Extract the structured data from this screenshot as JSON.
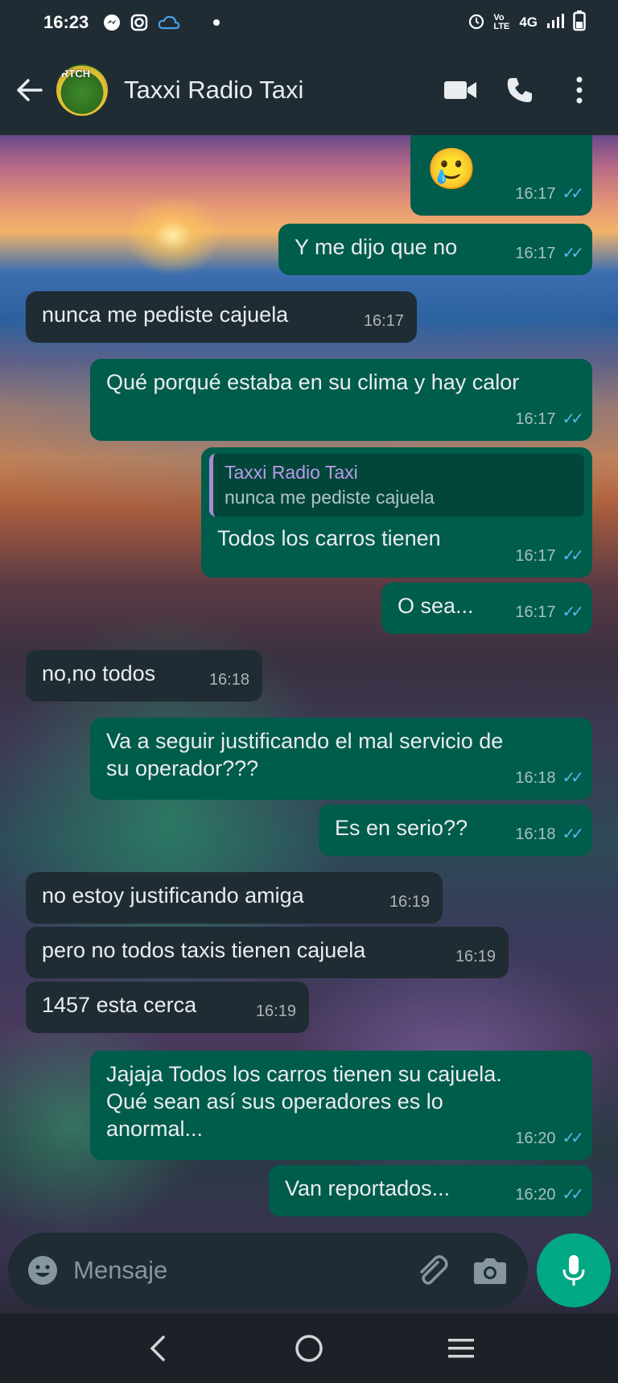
{
  "status_bar": {
    "time": "16:23",
    "icons": [
      "messenger-icon",
      "instagram-icon",
      "cloud-icon",
      "dot-icon"
    ],
    "right_icons": [
      "alarm-icon",
      "volte-icon",
      "signal-icon",
      "battery-icon"
    ],
    "network": "4G",
    "volte_label": "Vo LTE"
  },
  "header": {
    "contact_name": "Taxxi Radio Taxi",
    "avatar_text": "RTCH"
  },
  "messages": [
    {
      "dir": "out",
      "text": "🥲",
      "time": "16:17",
      "read": true
    },
    {
      "dir": "out",
      "text": "Y me dijo que no",
      "time": "16:17",
      "read": true
    },
    {
      "dir": "in",
      "text": "nunca me pediste cajuela",
      "time": "16:17"
    },
    {
      "dir": "out",
      "text": "Qué porqué estaba en su clima y hay calor",
      "time": "16:17",
      "read": true
    },
    {
      "dir": "out",
      "text": "Todos los carros tienen",
      "time": "16:17",
      "read": true,
      "quote": {
        "name": "Taxxi Radio Taxi",
        "text": "nunca me pediste cajuela"
      }
    },
    {
      "dir": "out",
      "text": "O sea...",
      "time": "16:17",
      "read": true
    },
    {
      "dir": "in",
      "text": "no,no todos",
      "time": "16:18"
    },
    {
      "dir": "out",
      "text": "Va a seguir justificando el mal servicio de su operador???",
      "time": "16:18",
      "read": true
    },
    {
      "dir": "out",
      "text": "Es en serio??",
      "time": "16:18",
      "read": true
    },
    {
      "dir": "in",
      "text": "no estoy justificando amiga",
      "time": "16:19"
    },
    {
      "dir": "in",
      "text": "pero no todos taxis tienen cajuela",
      "time": "16:19"
    },
    {
      "dir": "in",
      "text": "1457 esta cerca",
      "time": "16:19"
    },
    {
      "dir": "out",
      "text": "Jajaja Todos los carros tienen su cajuela. Qué sean así sus operadores es lo anormal...",
      "time": "16:20",
      "read": true
    },
    {
      "dir": "out",
      "text": "Van reportados...",
      "time": "16:20",
      "read": true
    }
  ],
  "composer": {
    "placeholder": "Mensaje"
  },
  "colors": {
    "outgoing_bubble": "#005c4b",
    "incoming_bubble": "#202c33",
    "read_tick": "#53bdeb",
    "mic_button": "#00a884",
    "header_bg": "#1f2c34"
  }
}
